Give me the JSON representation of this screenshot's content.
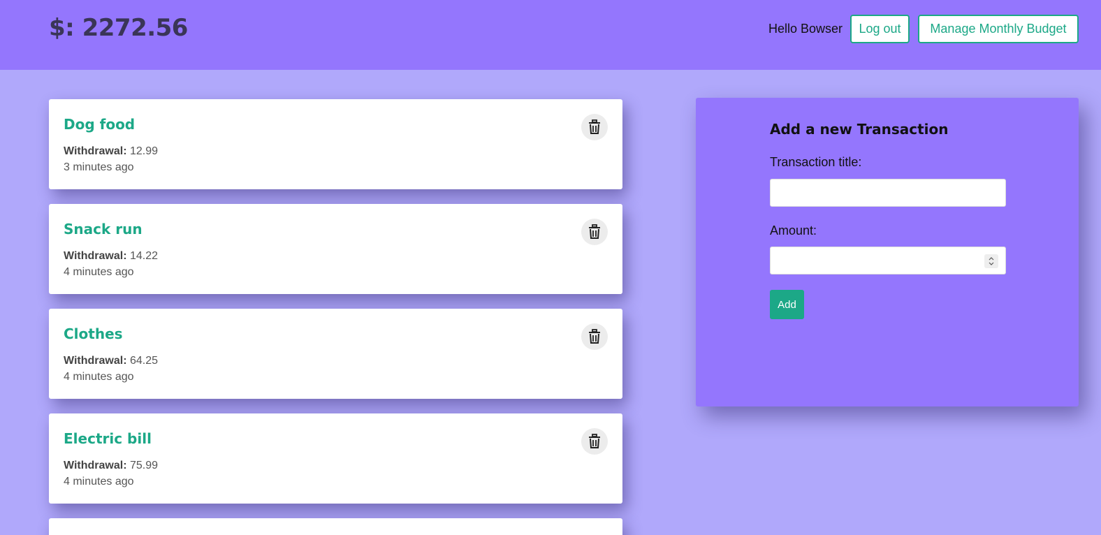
{
  "header": {
    "balance": "$: 2272.56",
    "greeting": "Hello Bowser",
    "logout_label": "Log out",
    "budget_label": "Manage Monthly Budget"
  },
  "transactions": [
    {
      "title": "Dog food",
      "type_label": "Withdrawal:",
      "amount": "12.99",
      "time": "3 minutes ago"
    },
    {
      "title": "Snack run",
      "type_label": "Withdrawal:",
      "amount": "14.22",
      "time": "4 minutes ago"
    },
    {
      "title": "Clothes",
      "type_label": "Withdrawal:",
      "amount": "64.25",
      "time": "4 minutes ago"
    },
    {
      "title": "Electric bill",
      "type_label": "Withdrawal:",
      "amount": "75.99",
      "time": "4 minutes ago"
    }
  ],
  "form": {
    "heading": "Add a new Transaction",
    "title_label": "Transaction title:",
    "title_value": "",
    "amount_label": "Amount:",
    "amount_value": "",
    "add_label": "Add"
  },
  "icons": {
    "delete": "trash-icon"
  },
  "colors": {
    "header_bg": "#9476fd",
    "page_bg": "#b0a8fb",
    "accent": "#1ca887"
  }
}
